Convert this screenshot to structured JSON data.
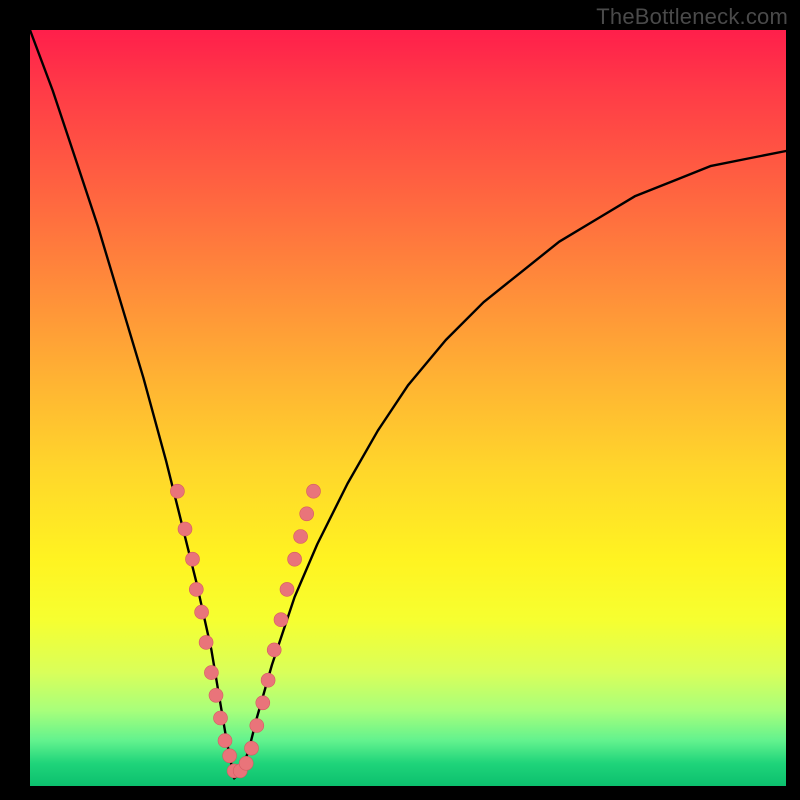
{
  "watermark": "TheBottleneck.com",
  "colors": {
    "frame": "#000000",
    "watermark": "#4a4a4a",
    "curve": "#000000",
    "points_fill": "#e9747a",
    "points_stroke": "#d55b62",
    "gradient_stops": [
      "#ff1f4b",
      "#ff3b47",
      "#ff6640",
      "#ff8c3a",
      "#ffb233",
      "#ffd62b",
      "#fff321",
      "#f6ff30",
      "#d9ff5a",
      "#a8ff7b",
      "#62f28e",
      "#1fd47a",
      "#0cc06e"
    ]
  },
  "chart_data": {
    "type": "line",
    "title": "",
    "xlabel": "",
    "ylabel": "",
    "xlim": [
      0,
      100
    ],
    "ylim": [
      0,
      100
    ],
    "grid": false,
    "legend": false,
    "note": "V-shaped bottleneck curve; y falls from ~100 to 0 at x≈27 then rises toward ~84 at x=100. Salmon points cluster near the minimum on both branches.",
    "series": [
      {
        "name": "bottleneck-curve",
        "x": [
          0,
          3,
          6,
          9,
          12,
          15,
          18,
          20,
          22,
          24,
          25,
          26,
          27,
          28,
          29,
          30,
          32,
          35,
          38,
          42,
          46,
          50,
          55,
          60,
          65,
          70,
          75,
          80,
          85,
          90,
          95,
          100
        ],
        "y": [
          100,
          92,
          83,
          74,
          64,
          54,
          43,
          35,
          27,
          18,
          12,
          6,
          1,
          2,
          5,
          9,
          16,
          25,
          32,
          40,
          47,
          53,
          59,
          64,
          68,
          72,
          75,
          78,
          80,
          82,
          83,
          84
        ]
      }
    ],
    "points": {
      "name": "highlight-points",
      "coords": [
        [
          19.5,
          39
        ],
        [
          20.5,
          34
        ],
        [
          21.5,
          30
        ],
        [
          22.0,
          26
        ],
        [
          22.7,
          23
        ],
        [
          23.3,
          19
        ],
        [
          24.0,
          15
        ],
        [
          24.6,
          12
        ],
        [
          25.2,
          9
        ],
        [
          25.8,
          6
        ],
        [
          26.4,
          4
        ],
        [
          27.0,
          2
        ],
        [
          27.8,
          2
        ],
        [
          28.6,
          3
        ],
        [
          29.3,
          5
        ],
        [
          30.0,
          8
        ],
        [
          30.8,
          11
        ],
        [
          31.5,
          14
        ],
        [
          32.3,
          18
        ],
        [
          33.2,
          22
        ],
        [
          34.0,
          26
        ],
        [
          35.0,
          30
        ],
        [
          35.8,
          33
        ],
        [
          36.6,
          36
        ],
        [
          37.5,
          39
        ]
      ]
    }
  }
}
